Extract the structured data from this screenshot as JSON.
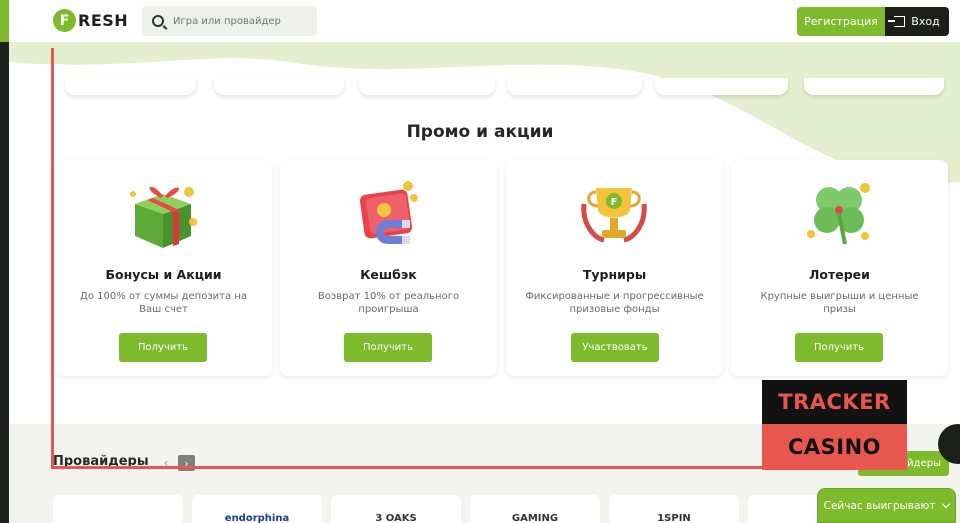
{
  "header": {
    "logo_letter": "F",
    "logo_text": "RESH",
    "search_placeholder": "Игра или провайдер",
    "register_label": "Регистрация",
    "login_label": "Вход"
  },
  "promo": {
    "title": "Промо и акции",
    "cards": [
      {
        "title": "Бонусы и Акции",
        "desc": "До 100% от суммы депозита на Ваш счет",
        "button": "Получить",
        "icon": "gift-icon"
      },
      {
        "title": "Кешбэк",
        "desc": "Возврат 10% от реального проигрыша",
        "button": "Получить",
        "icon": "wallet-magnet-icon"
      },
      {
        "title": "Турниры",
        "desc": "Фиксированные и прогрессивные призовые фонды",
        "button": "Участвовать",
        "icon": "trophy-icon"
      },
      {
        "title": "Лотереи",
        "desc": "Крупные выигрыши и ценные призы",
        "button": "Получить",
        "icon": "clover-icon"
      }
    ]
  },
  "providers": {
    "label": "Провайдеры",
    "all_label": "вайдеры",
    "tiles": [
      "",
      "endorphina",
      "3 OAKS",
      "GAMING",
      "1SPIN",
      ""
    ]
  },
  "watermark": {
    "line1": "TRACKER",
    "line2": "CASINO"
  },
  "now_winning_label": "Сейчас выигрывают",
  "colors": {
    "accent": "#7dbb2c",
    "dark": "#1d1f1b",
    "frame": "#e8574e"
  }
}
